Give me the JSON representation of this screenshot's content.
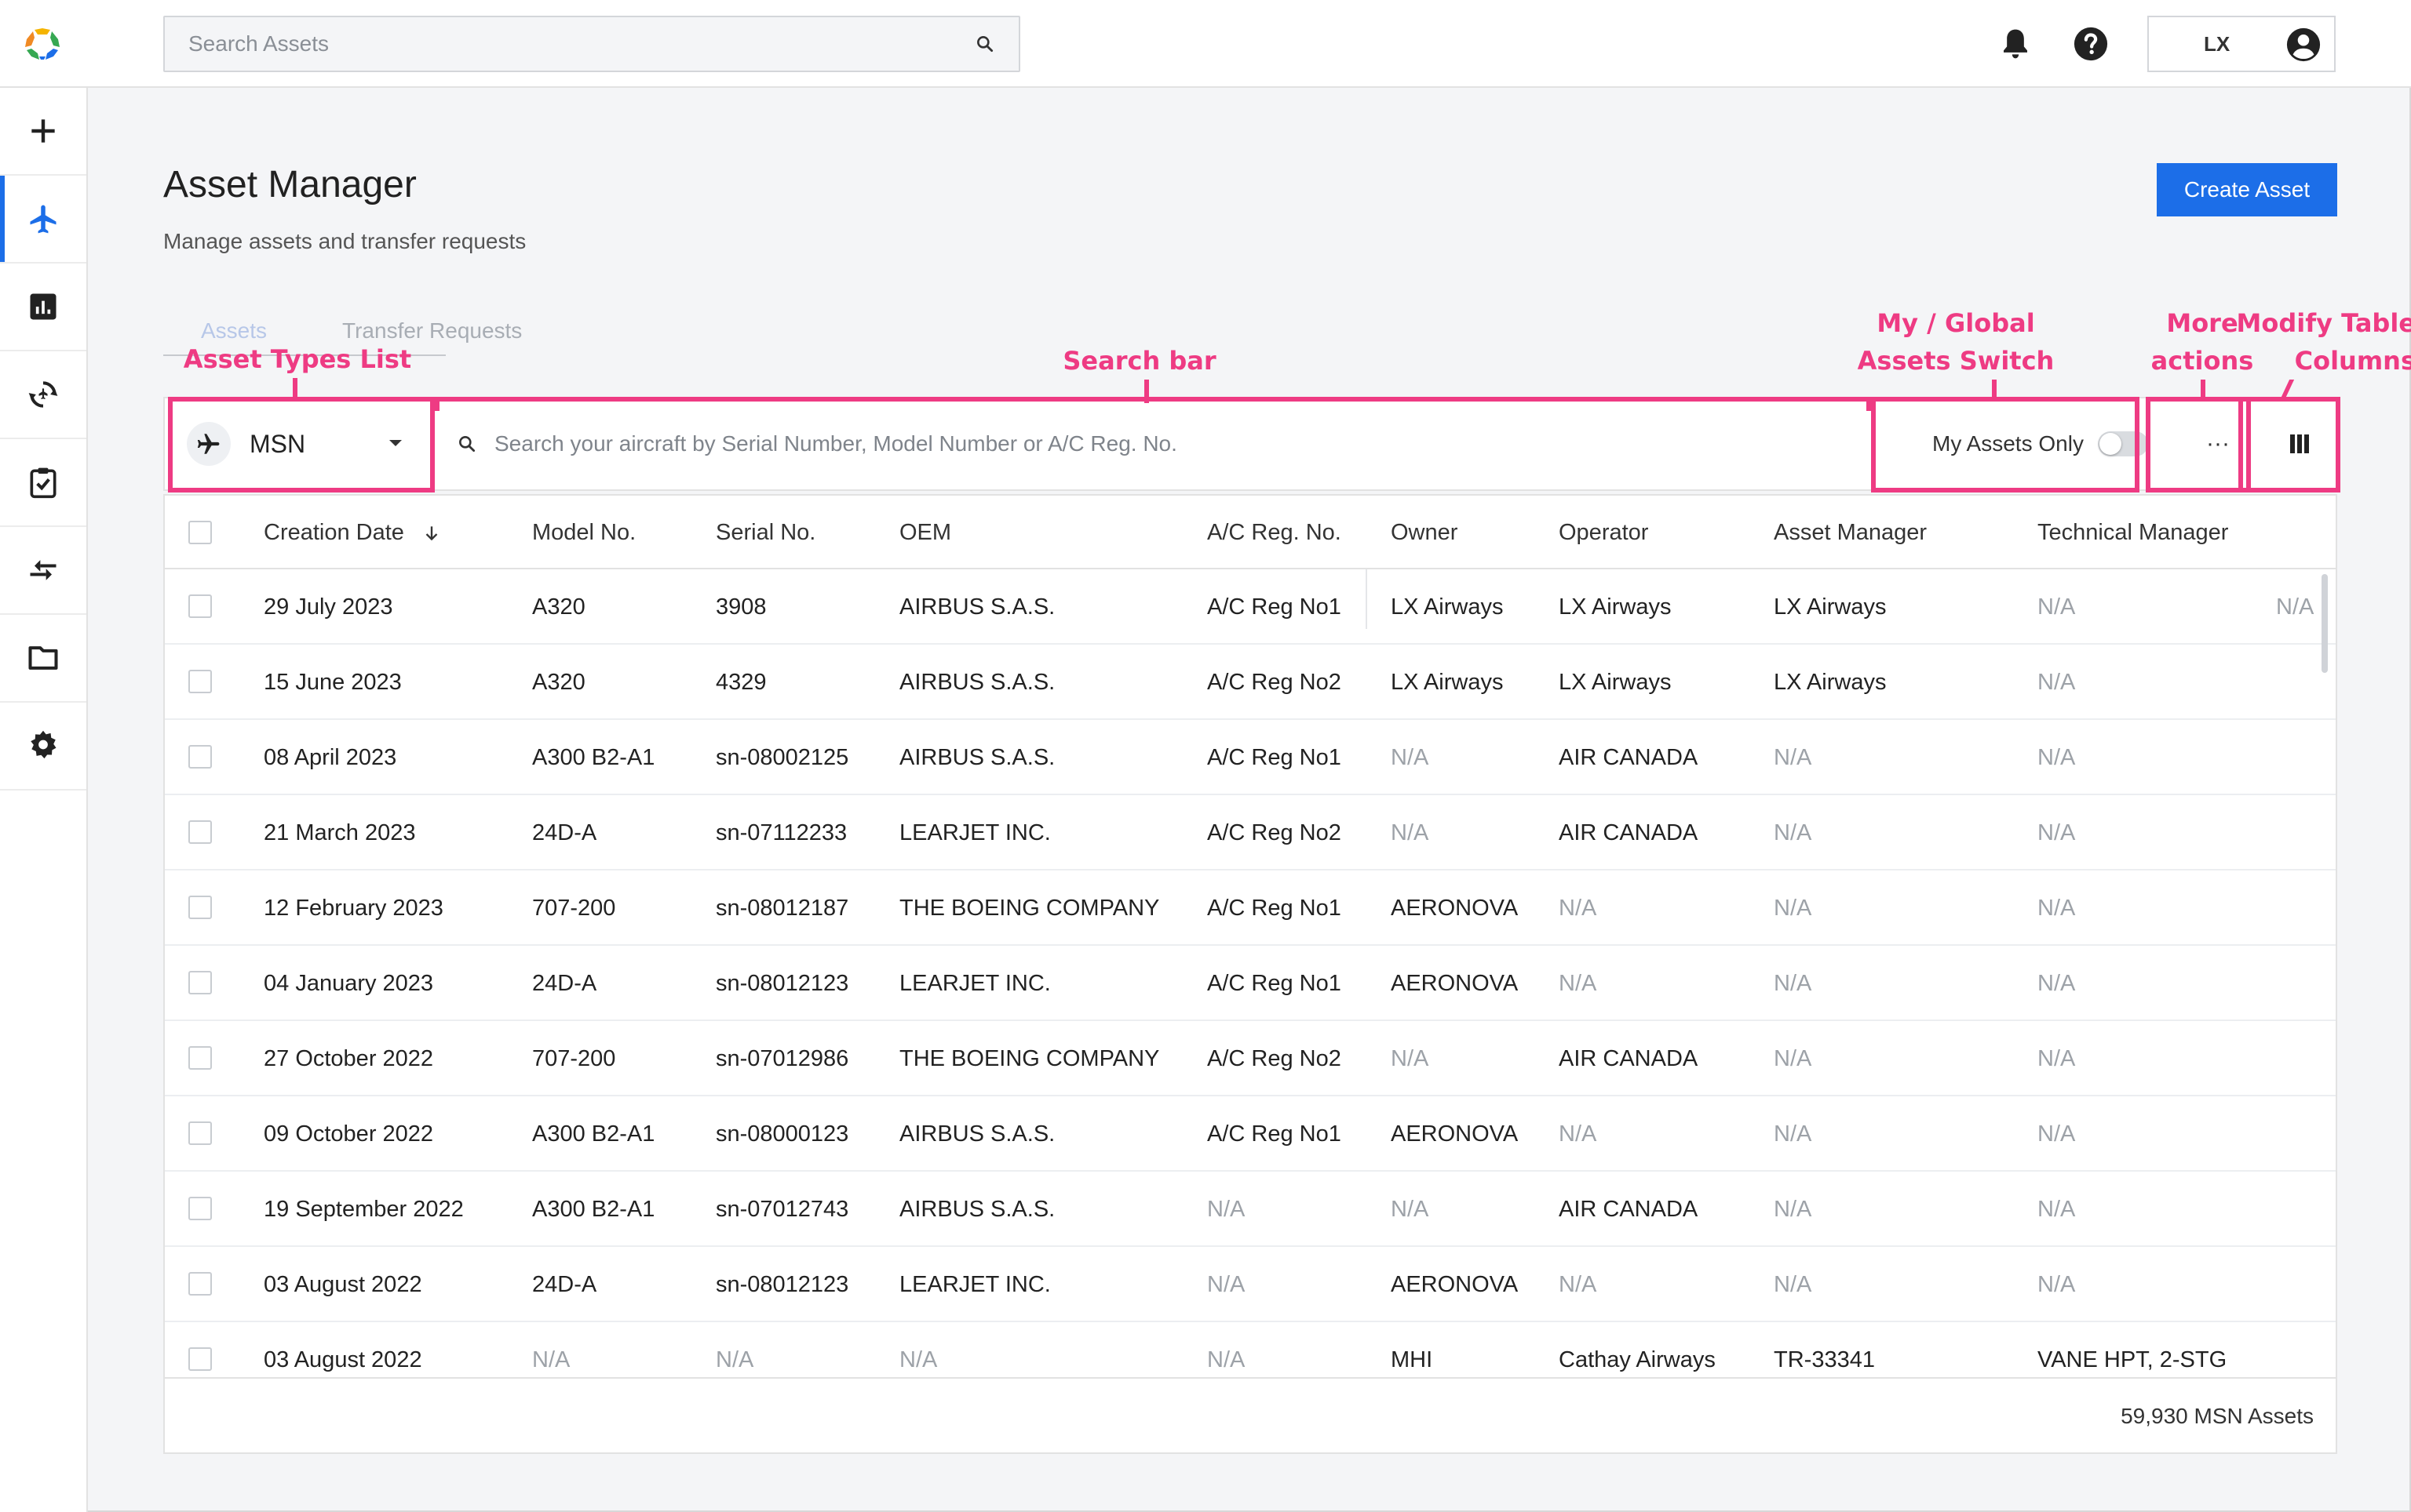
{
  "topbar": {
    "search_placeholder": "Search Assets",
    "user_initials": "LX",
    "icons": [
      "logo",
      "search-icon",
      "bell-icon",
      "help-icon",
      "account-circle-icon"
    ]
  },
  "sidebar": {
    "items": [
      {
        "name": "add",
        "icon": "plus-icon"
      },
      {
        "name": "assets",
        "icon": "airplane-icon",
        "active": true
      },
      {
        "name": "reports",
        "icon": "bar-chart-icon"
      },
      {
        "name": "tracking",
        "icon": "sync-icon"
      },
      {
        "name": "tasks",
        "icon": "clipboard-check-icon"
      },
      {
        "name": "transfers",
        "icon": "swap-icon"
      },
      {
        "name": "documents",
        "icon": "folder-icon"
      },
      {
        "name": "settings",
        "icon": "gear-icon"
      }
    ]
  },
  "page": {
    "title": "Asset Manager",
    "subtitle": "Manage assets and transfer requests",
    "create_button": "Create Asset",
    "tabs": [
      {
        "label": "Assets",
        "active": true
      },
      {
        "label": "Transfer Requests",
        "active": false
      }
    ]
  },
  "annotations": {
    "asset_types": "Asset Types List",
    "search_bar": "Search bar",
    "switch_line1": "My / Global",
    "switch_line2": "Assets Switch",
    "more_line1": "More",
    "more_line2": "actions",
    "modify_line1": "Modify Table",
    "modify_line2": "Columns",
    "color": "#ee3b83"
  },
  "filters": {
    "asset_type": "MSN",
    "search_placeholder": "Search your aircraft by Serial Number, Model Number or A/C Reg. No.",
    "my_assets_label": "My Assets Only",
    "my_assets_on": false,
    "more_label": "···"
  },
  "table": {
    "columns": [
      "Creation Date",
      "Model No.",
      "Serial No.",
      "OEM",
      "A/C Reg. No.",
      "Owner",
      "Operator",
      "Asset Manager",
      "Technical Manager"
    ],
    "sort_column": "Creation Date",
    "sort_direction": "descending",
    "extra_first_row_value": "N/A",
    "rows": [
      [
        "29 July 2023",
        "A320",
        "3908",
        "AIRBUS S.A.S.",
        "A/C Reg No1",
        "LX Airways",
        "LX Airways",
        "LX Airways",
        "N/A"
      ],
      [
        "15 June 2023",
        "A320",
        "4329",
        "AIRBUS S.A.S.",
        "A/C Reg No2",
        "LX Airways",
        "LX Airways",
        "LX Airways",
        "N/A"
      ],
      [
        "08 April 2023",
        "A300 B2-A1",
        "sn-08002125",
        "AIRBUS S.A.S.",
        "A/C Reg No1",
        "N/A",
        "AIR CANADA",
        "N/A",
        "N/A"
      ],
      [
        "21 March 2023",
        "24D-A",
        "sn-07112233",
        "LEARJET INC.",
        "A/C Reg No2",
        "N/A",
        "AIR CANADA",
        "N/A",
        "N/A"
      ],
      [
        "12 February 2023",
        "707-200",
        "sn-08012187",
        "THE BOEING COMPANY",
        "A/C Reg No1",
        "AERONOVA",
        "N/A",
        "N/A",
        "N/A"
      ],
      [
        "04 January 2023",
        "24D-A",
        "sn-08012123",
        "LEARJET INC.",
        "A/C Reg No1",
        "AERONOVA",
        "N/A",
        "N/A",
        "N/A"
      ],
      [
        "27 October 2022",
        "707-200",
        "sn-07012986",
        "THE BOEING COMPANY",
        "A/C Reg No2",
        "N/A",
        "AIR CANADA",
        "N/A",
        "N/A"
      ],
      [
        "09 October 2022",
        "A300 B2-A1",
        "sn-08000123",
        "AIRBUS S.A.S.",
        "A/C Reg No1",
        "AERONOVA",
        "N/A",
        "N/A",
        "N/A"
      ],
      [
        "19 September 2022",
        "A300 B2-A1",
        "sn-07012743",
        "AIRBUS S.A.S.",
        "N/A",
        "N/A",
        "AIR CANADA",
        "N/A",
        "N/A"
      ],
      [
        "03 August 2022",
        "24D-A",
        "sn-08012123",
        "LEARJET INC.",
        "N/A",
        "AERONOVA",
        "N/A",
        "N/A",
        "N/A"
      ],
      [
        "03 August 2022",
        "N/A",
        "N/A",
        "N/A",
        "N/A",
        "MHI",
        "Cathay Airways",
        "TR-33341",
        "VANE HPT, 2-STG"
      ]
    ],
    "footer_total": "59,930 MSN Assets"
  },
  "colors": {
    "primary": "#1c6ee8",
    "annotation": "#ee3b83",
    "background": "#f4f5f7"
  }
}
